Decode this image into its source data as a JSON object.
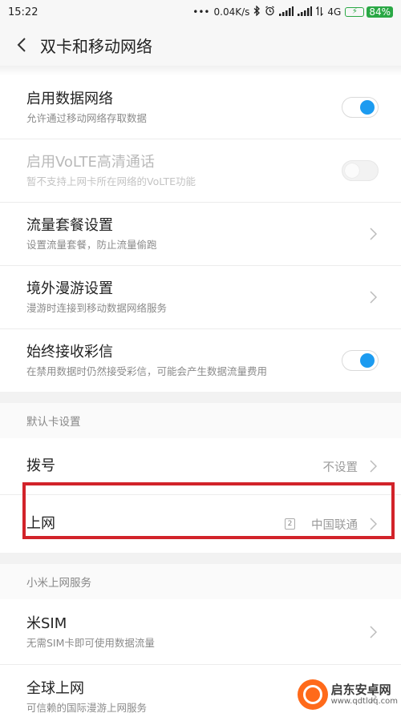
{
  "status_bar": {
    "time": "15:22",
    "network_speed": "0.04K/s",
    "network_type": "4G",
    "battery_pct": "84%"
  },
  "header": {
    "title": "双卡和移动网络"
  },
  "settings": {
    "data_network": {
      "title": "启用数据网络",
      "subtitle": "允许通过移动网络存取数据",
      "enabled": true
    },
    "volte": {
      "title": "启用VoLTE高清通话",
      "subtitle": "暂不支持上网卡所在网络的VoLTE功能",
      "enabled": false
    },
    "data_plan": {
      "title": "流量套餐设置",
      "subtitle": "设置流量套餐，防止流量偷跑"
    },
    "roaming": {
      "title": "境外漫游设置",
      "subtitle": "漫游时连接到移动数据网络服务"
    },
    "mms": {
      "title": "始终接收彩信",
      "subtitle": "在禁用数据时仍然接受彩信，可能会产生数据流量费用",
      "enabled": true
    }
  },
  "default_card": {
    "header": "默认卡设置",
    "dial": {
      "title": "拨号",
      "value": "不设置"
    },
    "internet": {
      "title": "上网",
      "sim_badge": "2",
      "value": "中国联通"
    }
  },
  "mi_service": {
    "header": "小米上网服务",
    "mi_sim": {
      "title": "米SIM",
      "subtitle": "无需SIM卡即可使用数据流量"
    },
    "global": {
      "title": "全球上网",
      "subtitle": "可信赖的国际漫游上网服务"
    }
  },
  "watermark": {
    "name": "启东安卓网",
    "url": "www.qdtldq.com"
  },
  "colors": {
    "accent": "#1c9bf0",
    "highlight": "#d2232a"
  }
}
